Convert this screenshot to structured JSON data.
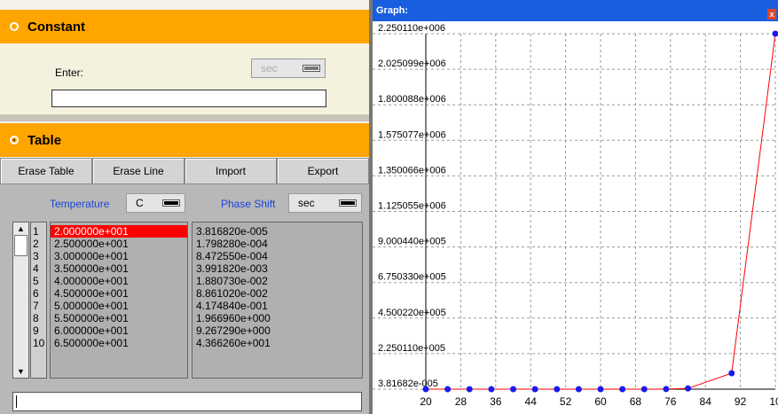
{
  "constant": {
    "label": "Constant",
    "enter_label": "Enter:",
    "unit": "sec",
    "value": ""
  },
  "table": {
    "label": "Table",
    "buttons": [
      "Erase Table",
      "Erase Line",
      "Import",
      "Export"
    ],
    "temperature_label": "Temperature",
    "temperature_unit": "C",
    "phase_label": "Phase Shift",
    "phase_unit": "sec",
    "selected_row": 0,
    "rows": [
      {
        "n": "1",
        "temp": "2.000000e+001",
        "phase": "3.816820e-005"
      },
      {
        "n": "2",
        "temp": "2.500000e+001",
        "phase": "1.798280e-004"
      },
      {
        "n": "3",
        "temp": "3.000000e+001",
        "phase": "8.472550e-004"
      },
      {
        "n": "4",
        "temp": "3.500000e+001",
        "phase": "3.991820e-003"
      },
      {
        "n": "5",
        "temp": "4.000000e+001",
        "phase": "1.880730e-002"
      },
      {
        "n": "6",
        "temp": "4.500000e+001",
        "phase": "8.861020e-002"
      },
      {
        "n": "7",
        "temp": "5.000000e+001",
        "phase": "4.174840e-001"
      },
      {
        "n": "8",
        "temp": "5.500000e+001",
        "phase": "1.966960e+000"
      },
      {
        "n": "9",
        "temp": "6.000000e+001",
        "phase": "9.267290e+000"
      },
      {
        "n": "10",
        "temp": "6.500000e+001",
        "phase": "4.366260e+001"
      }
    ]
  },
  "status": {
    "value": ""
  },
  "graph": {
    "title": "Graph:",
    "close": "x"
  },
  "chart_data": {
    "type": "line",
    "title": "",
    "xlabel": "",
    "ylabel": "",
    "x_ticks": [
      "20",
      "28",
      "36",
      "44",
      "52",
      "60",
      "68",
      "76",
      "84",
      "92",
      "10"
    ],
    "y_ticks": [
      "3.81682e-005",
      "2.250110e+005",
      "4.500220e+005",
      "6.750330e+005",
      "9.000440e+005",
      "1.125055e+006",
      "1.350066e+006",
      "1.575077e+006",
      "1.800088e+006",
      "2.025099e+006",
      "2.250110e+006"
    ],
    "xlim": [
      20,
      100
    ],
    "ylim": [
      0,
      2250110
    ],
    "grid": true,
    "line_color": "#ff0000",
    "marker_color": "#1a1aee",
    "series": [
      {
        "x": [
          20,
          25,
          30,
          35,
          40,
          45,
          50,
          55,
          60,
          65,
          70,
          75,
          80,
          90,
          100
        ],
        "y": [
          3.82e-05,
          0.00018,
          0.00085,
          0.004,
          0.0188,
          0.0886,
          0.417,
          1.97,
          9.27,
          43.7,
          206,
          970,
          4570,
          101000,
          2250110
        ]
      }
    ]
  }
}
